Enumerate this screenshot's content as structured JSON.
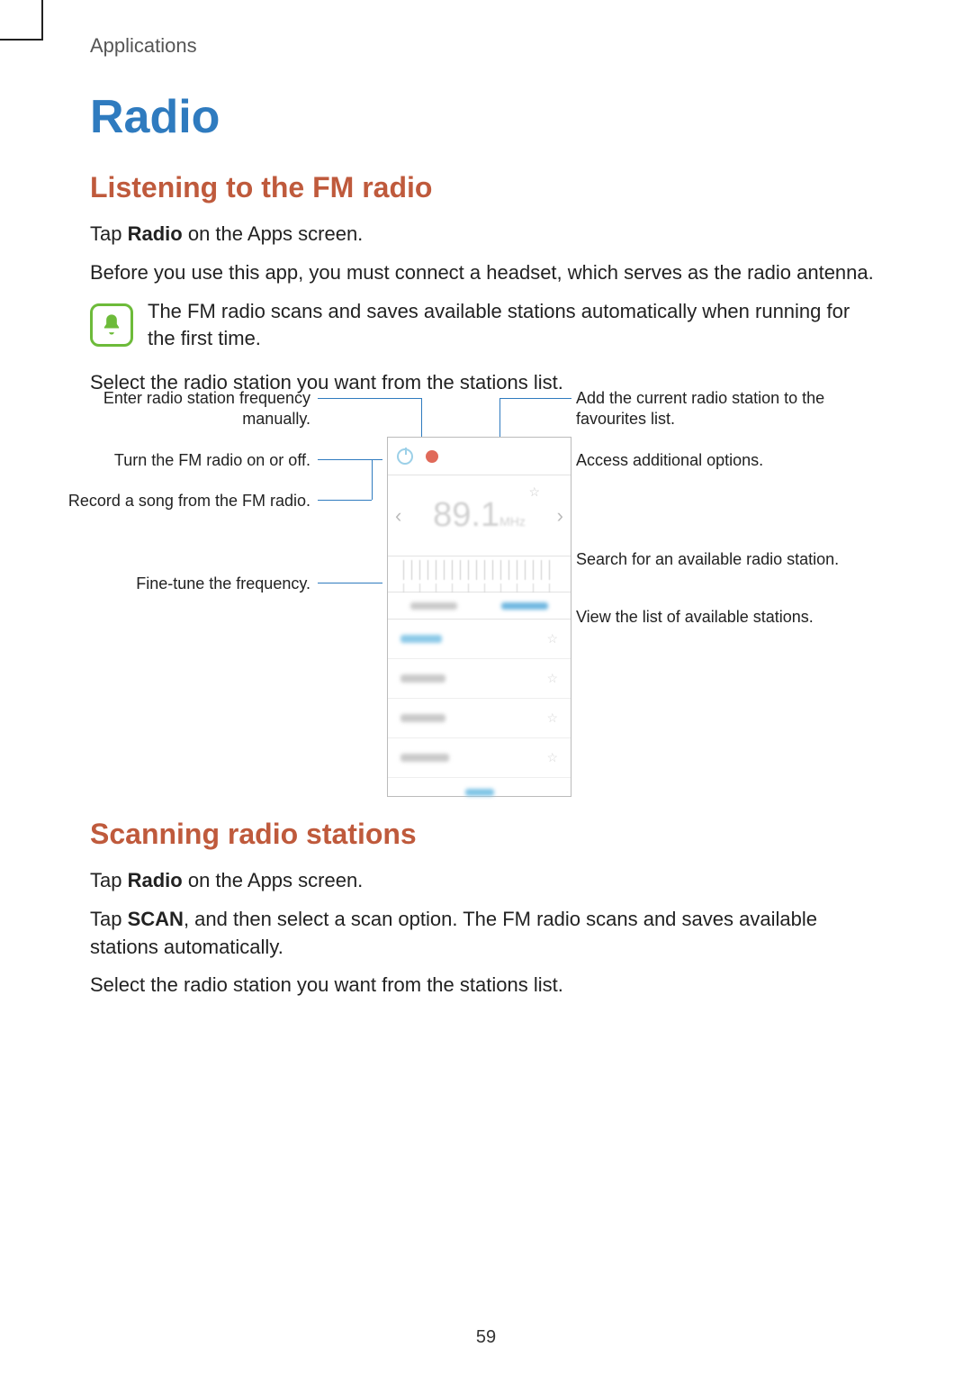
{
  "breadcrumb": "Applications",
  "title": "Radio",
  "section1": {
    "heading": "Listening to the FM radio",
    "p1_a": "Tap ",
    "p1_b": "Radio",
    "p1_c": " on the Apps screen.",
    "p2": "Before you use this app, you must connect a headset, which serves as the radio antenna.",
    "note": "The FM radio scans and saves available stations automatically when running for the first time.",
    "p3": "Select the radio station you want from the stations list."
  },
  "figure": {
    "frequency": "89.1",
    "freq_unit": "MHz",
    "callouts": {
      "manual": "Enter radio station frequency manually.",
      "power": "Turn the FM radio on or off.",
      "record": "Record a song from the FM radio.",
      "finetune": "Fine-tune the frequency.",
      "fav": "Add the current radio station to the favourites list.",
      "options": "Access additional options.",
      "search": "Search for an available radio station.",
      "viewlist": "View the list of available stations."
    }
  },
  "section2": {
    "heading": "Scanning radio stations",
    "p1_a": "Tap ",
    "p1_b": "Radio",
    "p1_c": " on the Apps screen.",
    "p2_a": "Tap ",
    "p2_b": "SCAN",
    "p2_c": ", and then select a scan option. The FM radio scans and saves available stations automatically.",
    "p3": "Select the radio station you want from the stations list."
  },
  "page_number": "59"
}
